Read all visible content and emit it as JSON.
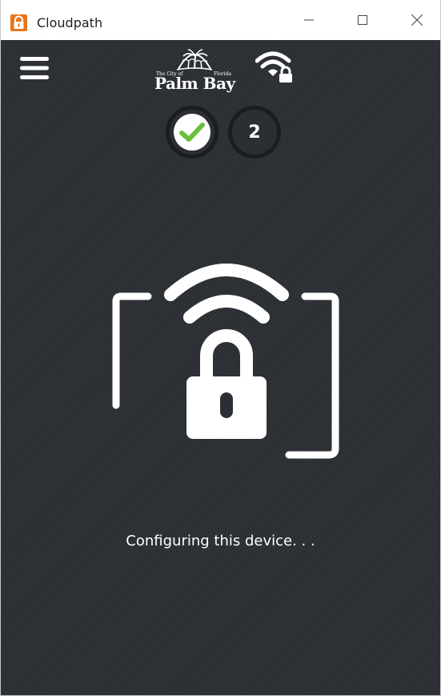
{
  "window": {
    "title": "Cloudpath",
    "controls": [
      "minimize",
      "maximize",
      "close"
    ]
  },
  "header": {
    "menu_icon": "hamburger-menu-icon",
    "logo": {
      "top_left_small": "The City of",
      "top_right_small": "Florida",
      "name": "Palm Bay"
    },
    "network_icon": "wifi-lock-icon"
  },
  "steps": [
    {
      "state": "completed",
      "icon": "checkmark-icon"
    },
    {
      "state": "current",
      "label": "2"
    }
  ],
  "main": {
    "illustration": "wifi-lock-illustration",
    "status_text": "Configuring this device. . ."
  },
  "colors": {
    "background": "#2b2f33",
    "check_green": "#6cbf3b",
    "app_icon_orange": "#e8731b",
    "foreground": "#ffffff"
  }
}
